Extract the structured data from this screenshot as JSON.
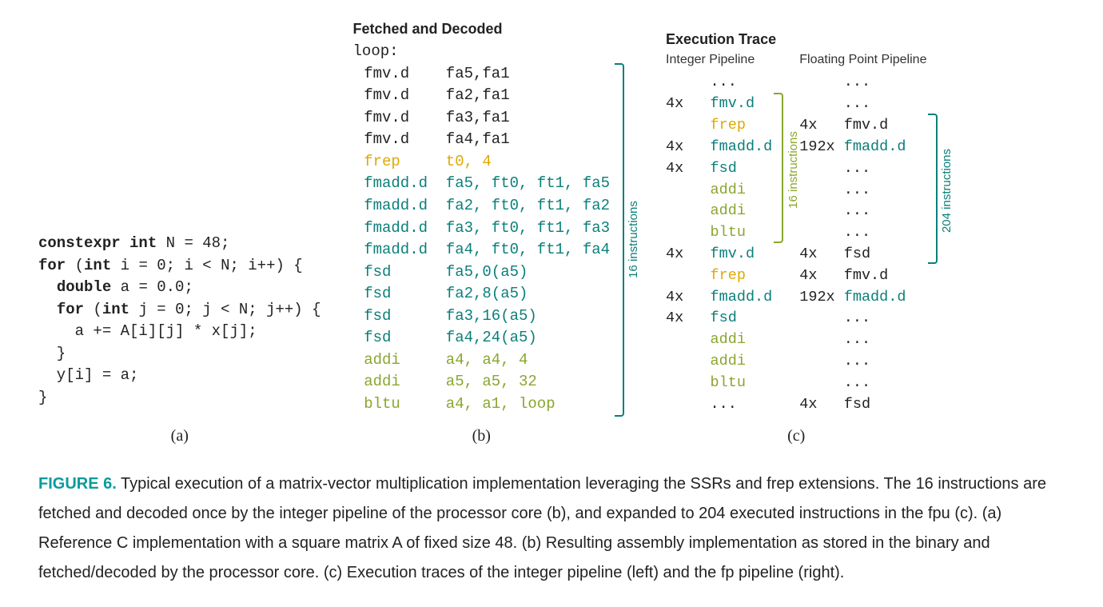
{
  "panel_a": {
    "code_lines": [
      {
        "segments": [
          {
            "t": "constexpr int",
            "kw": true
          },
          {
            "t": " N = 48;"
          }
        ]
      },
      {
        "segments": [
          {
            "t": "for",
            "kw": true
          },
          {
            "t": " ("
          },
          {
            "t": "int",
            "kw": true
          },
          {
            "t": " i = 0; i < N; i++) {"
          }
        ]
      },
      {
        "segments": [
          {
            "t": "  "
          },
          {
            "t": "double",
            "kw": true
          },
          {
            "t": " a = 0.0;"
          }
        ]
      },
      {
        "segments": [
          {
            "t": "  "
          },
          {
            "t": "for",
            "kw": true
          },
          {
            "t": " ("
          },
          {
            "t": "int",
            "kw": true
          },
          {
            "t": " j = 0; j < N; j++) {"
          }
        ]
      },
      {
        "segments": [
          {
            "t": "    a += A[i][j] * x[j];"
          }
        ]
      },
      {
        "segments": [
          {
            "t": "  }"
          }
        ]
      },
      {
        "segments": [
          {
            "t": "  y[i] = a;"
          }
        ]
      },
      {
        "segments": [
          {
            "t": "}"
          }
        ]
      }
    ],
    "label": "(a)"
  },
  "panel_b": {
    "header": "Fetched and Decoded",
    "label_line": "loop:",
    "lines": [
      {
        "op": "fmv.d",
        "args": "fa5,fa1",
        "cls": ""
      },
      {
        "op": "fmv.d",
        "args": "fa2,fa1",
        "cls": ""
      },
      {
        "op": "fmv.d",
        "args": "fa3,fa1",
        "cls": ""
      },
      {
        "op": "fmv.d",
        "args": "fa4,fa1",
        "cls": ""
      },
      {
        "op": "frep",
        "args": "t0, 4",
        "cls": "c-orange"
      },
      {
        "op": "fmadd.d",
        "args": "fa5, ft0, ft1, fa5",
        "cls": "c-teal"
      },
      {
        "op": "fmadd.d",
        "args": "fa2, ft0, ft1, fa2",
        "cls": "c-teal"
      },
      {
        "op": "fmadd.d",
        "args": "fa3, ft0, ft1, fa3",
        "cls": "c-teal"
      },
      {
        "op": "fmadd.d",
        "args": "fa4, ft0, ft1, fa4",
        "cls": "c-teal"
      },
      {
        "op": "fsd",
        "args": "fa5,0(a5)",
        "cls": "c-teal"
      },
      {
        "op": "fsd",
        "args": "fa2,8(a5)",
        "cls": "c-teal"
      },
      {
        "op": "fsd",
        "args": "fa3,16(a5)",
        "cls": "c-teal"
      },
      {
        "op": "fsd",
        "args": "fa4,24(a5)",
        "cls": "c-teal"
      },
      {
        "op": "addi",
        "args": "a4, a4, 4",
        "cls": "c-olive"
      },
      {
        "op": "addi",
        "args": "a5, a5, 32",
        "cls": "c-olive"
      },
      {
        "op": "bltu",
        "args": "a4, a1, loop",
        "cls": "c-olive"
      }
    ],
    "bracket_label": "16 instructions",
    "label": "(b)"
  },
  "panel_c": {
    "title": "Execution Trace",
    "int_pipe": {
      "subtitle": "Integer Pipeline",
      "lines": [
        {
          "count": "",
          "op": "...",
          "cls": ""
        },
        {
          "count": "4x",
          "op": "fmv.d",
          "cls": "c-teal"
        },
        {
          "count": "",
          "op": "frep",
          "cls": "c-orange"
        },
        {
          "count": "4x",
          "op": "fmadd.d",
          "cls": "c-teal"
        },
        {
          "count": "4x",
          "op": "fsd",
          "cls": "c-teal"
        },
        {
          "count": "",
          "op": "addi",
          "cls": "c-olive"
        },
        {
          "count": "",
          "op": "addi",
          "cls": "c-olive"
        },
        {
          "count": "",
          "op": "bltu",
          "cls": "c-olive"
        },
        {
          "count": "4x",
          "op": "fmv.d",
          "cls": "c-teal"
        },
        {
          "count": "",
          "op": "frep",
          "cls": "c-orange"
        },
        {
          "count": "4x",
          "op": "fmadd.d",
          "cls": "c-teal"
        },
        {
          "count": "4x",
          "op": "fsd",
          "cls": "c-teal"
        },
        {
          "count": "",
          "op": "addi",
          "cls": "c-olive"
        },
        {
          "count": "",
          "op": "addi",
          "cls": "c-olive"
        },
        {
          "count": "",
          "op": "bltu",
          "cls": "c-olive"
        },
        {
          "count": "",
          "op": "...",
          "cls": ""
        }
      ],
      "bracket_label": "16 instructions"
    },
    "fp_pipe": {
      "subtitle": "Floating Point Pipeline",
      "lines": [
        {
          "count": "",
          "op": "...",
          "cls": ""
        },
        {
          "count": "",
          "op": "...",
          "cls": ""
        },
        {
          "count": "4x",
          "op": "fmv.d",
          "cls": ""
        },
        {
          "count": "192x",
          "op": "fmadd.d",
          "cls": "c-teal"
        },
        {
          "count": "",
          "op": "...",
          "cls": ""
        },
        {
          "count": "",
          "op": "...",
          "cls": ""
        },
        {
          "count": "",
          "op": "...",
          "cls": ""
        },
        {
          "count": "",
          "op": "...",
          "cls": ""
        },
        {
          "count": "4x",
          "op": "fsd",
          "cls": ""
        },
        {
          "count": "4x",
          "op": "fmv.d",
          "cls": ""
        },
        {
          "count": "192x",
          "op": "fmadd.d",
          "cls": "c-teal"
        },
        {
          "count": "",
          "op": "...",
          "cls": ""
        },
        {
          "count": "",
          "op": "...",
          "cls": ""
        },
        {
          "count": "",
          "op": "...",
          "cls": ""
        },
        {
          "count": "",
          "op": "...",
          "cls": ""
        },
        {
          "count": "4x",
          "op": "fsd",
          "cls": ""
        }
      ],
      "bracket_label": "204 instructions"
    },
    "label": "(c)"
  },
  "caption": {
    "label": "FIGURE 6.",
    "text": " Typical execution of a matrix-vector multiplication implementation leveraging the SSRs and frep extensions. The 16 instructions are fetched and decoded once by the integer pipeline of the processor core (b), and expanded to 204 executed instructions in the fpu (c). (a) Reference C implementation with a square matrix A of fixed size 48. (b) Resulting assembly implementation as stored in the binary and fetched/decoded by the processor core. (c) Execution traces of the integer pipeline (left) and the fp pipeline (right)."
  },
  "colors": {
    "teal": "#0a7f7a",
    "orange": "#e0a800",
    "olive": "#8aa62f",
    "figlabel": "#0a9b9b"
  }
}
